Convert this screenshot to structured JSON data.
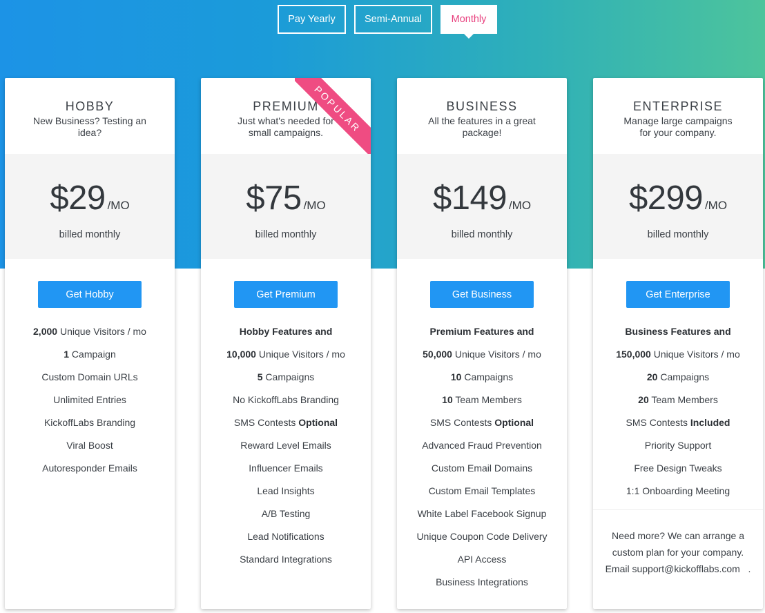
{
  "billing_toggle": {
    "options": [
      "Pay Yearly",
      "Semi-Annual",
      "Monthly"
    ],
    "selected": "Monthly"
  },
  "colors": {
    "accent_pink": "#e8407e",
    "cta_blue": "#2196f3",
    "gradient_start": "#1c93e6",
    "gradient_end": "#4dc49c",
    "ribbon": "#ef4c82"
  },
  "plans": [
    {
      "name": "HOBBY",
      "description": "New Business? Testing an idea?",
      "price": "$29",
      "unit": "/MO",
      "billing": "billed monthly",
      "cta": "Get Hobby",
      "features": [
        {
          "bold": "2,000",
          "text": " Unique Visitors / mo"
        },
        {
          "bold": "1",
          "text": " Campaign"
        },
        {
          "bold": "",
          "text": "Custom Domain URLs"
        },
        {
          "bold": "",
          "text": "Unlimited Entries"
        },
        {
          "bold": "",
          "text": "KickoffLabs Branding"
        },
        {
          "bold": "",
          "text": "Viral Boost"
        },
        {
          "bold": "",
          "text": "Autoresponder Emails"
        }
      ]
    },
    {
      "name": "PREMIUM",
      "description": "Just what's needed for small campaigns.",
      "badge": "POPULAR",
      "price": "$75",
      "unit": "/MO",
      "billing": "billed monthly",
      "cta": "Get Premium",
      "features": [
        {
          "bold": "Hobby Features and",
          "text": ""
        },
        {
          "bold": "10,000",
          "text": " Unique Visitors / mo"
        },
        {
          "bold": "5",
          "text": " Campaigns"
        },
        {
          "bold": "",
          "text": "No KickoffLabs Branding"
        },
        {
          "bold": "",
          "text": "SMS Contests ",
          "bold_after": "Optional"
        },
        {
          "bold": "",
          "text": "Reward Level Emails"
        },
        {
          "bold": "",
          "text": "Influencer Emails"
        },
        {
          "bold": "",
          "text": "Lead Insights"
        },
        {
          "bold": "",
          "text": "A/B Testing"
        },
        {
          "bold": "",
          "text": "Lead Notifications"
        },
        {
          "bold": "",
          "text": "Standard Integrations"
        }
      ]
    },
    {
      "name": "BUSINESS",
      "description": "All the features in a great package!",
      "price": "$149",
      "unit": "/MO",
      "billing": "billed monthly",
      "cta": "Get Business",
      "features": [
        {
          "bold": "Premium Features and",
          "text": ""
        },
        {
          "bold": "50,000",
          "text": " Unique Visitors / mo"
        },
        {
          "bold": "10",
          "text": " Campaigns"
        },
        {
          "bold": "10",
          "text": " Team Members"
        },
        {
          "bold": "",
          "text": "SMS Contests ",
          "bold_after": "Optional"
        },
        {
          "bold": "",
          "text": "Advanced Fraud Prevention"
        },
        {
          "bold": "",
          "text": "Custom Email Domains"
        },
        {
          "bold": "",
          "text": "Custom Email Templates"
        },
        {
          "bold": "",
          "text": "White Label Facebook Signup"
        },
        {
          "bold": "",
          "text": "Unique Coupon Code Delivery"
        },
        {
          "bold": "",
          "text": "API Access"
        },
        {
          "bold": "",
          "text": "Business Integrations"
        }
      ]
    },
    {
      "name": "ENTERPRISE",
      "description": "Manage large campaigns for your company.",
      "price": "$299",
      "unit": "/MO",
      "billing": "billed monthly",
      "cta": "Get Enterprise",
      "features": [
        {
          "bold": "Business Features and",
          "text": ""
        },
        {
          "bold": "150,000",
          "text": " Unique Visitors / mo"
        },
        {
          "bold": "20",
          "text": " Campaigns"
        },
        {
          "bold": "20",
          "text": " Team Members"
        },
        {
          "bold": "",
          "text": "SMS Contests ",
          "bold_after": "Included"
        },
        {
          "bold": "",
          "text": "Priority Support"
        },
        {
          "bold": "",
          "text": "Free Design Tweaks"
        },
        {
          "bold": "",
          "text": "1:1 Onboarding Meeting"
        }
      ],
      "note": {
        "text": "Need more? We can arrange a custom plan for your company. Email ",
        "email": "support@kickofflabs.com",
        "suffix": "   ."
      }
    }
  ]
}
